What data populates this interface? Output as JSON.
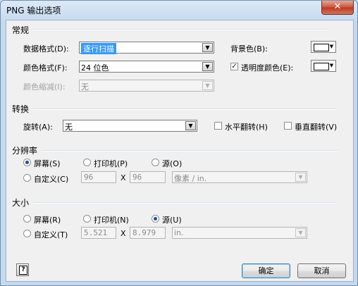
{
  "window": {
    "title": "PNG 输出选项",
    "close_glyph": "✕"
  },
  "general": {
    "heading": "常规",
    "data_format": {
      "label": "数据格式(D):",
      "value": "逐行扫描"
    },
    "color_format": {
      "label": "颜色格式(F):",
      "value": "24 位色"
    },
    "color_reduction": {
      "label": "颜色缩减(I):",
      "value": "无"
    },
    "background_color": {
      "label": "背景色(B):"
    },
    "transparency": {
      "label": "透明度颜色(E):",
      "checked": true
    }
  },
  "transform": {
    "heading": "转换",
    "rotation": {
      "label": "旋转(A):",
      "value": "无"
    },
    "flip_horizontal": {
      "label": "水平翻转(H)",
      "checked": false
    },
    "flip_vertical": {
      "label": "垂直翻转(V)",
      "checked": false
    }
  },
  "resolution": {
    "heading": "分辨率",
    "screen": {
      "label": "屏幕(S)",
      "selected": true
    },
    "printer": {
      "label": "打印机(P)",
      "selected": false
    },
    "source": {
      "label": "源(O)",
      "selected": false
    },
    "custom": {
      "label": "自定义(C)",
      "selected": false
    },
    "width": "96",
    "x_sep": "X",
    "height": "96",
    "unit": "像素 / in."
  },
  "size": {
    "heading": "大小",
    "screen": {
      "label": "屏幕(R)",
      "selected": false
    },
    "printer": {
      "label": "打印机(N)",
      "selected": false
    },
    "source": {
      "label": "源(U)",
      "selected": true
    },
    "custom": {
      "label": "自定义(T)",
      "selected": false
    },
    "width": "5.521",
    "x_sep": "X",
    "height": "8.979",
    "unit": "in."
  },
  "footer": {
    "help_glyph": "?",
    "ok_label": "确定",
    "cancel_label": "取消"
  },
  "icons": {
    "dropdown": "▼",
    "check": "✓"
  },
  "colors": {
    "accent": "#3399ff",
    "close_red": "#c8553d",
    "dialog_bg": "#f0f0f0"
  }
}
